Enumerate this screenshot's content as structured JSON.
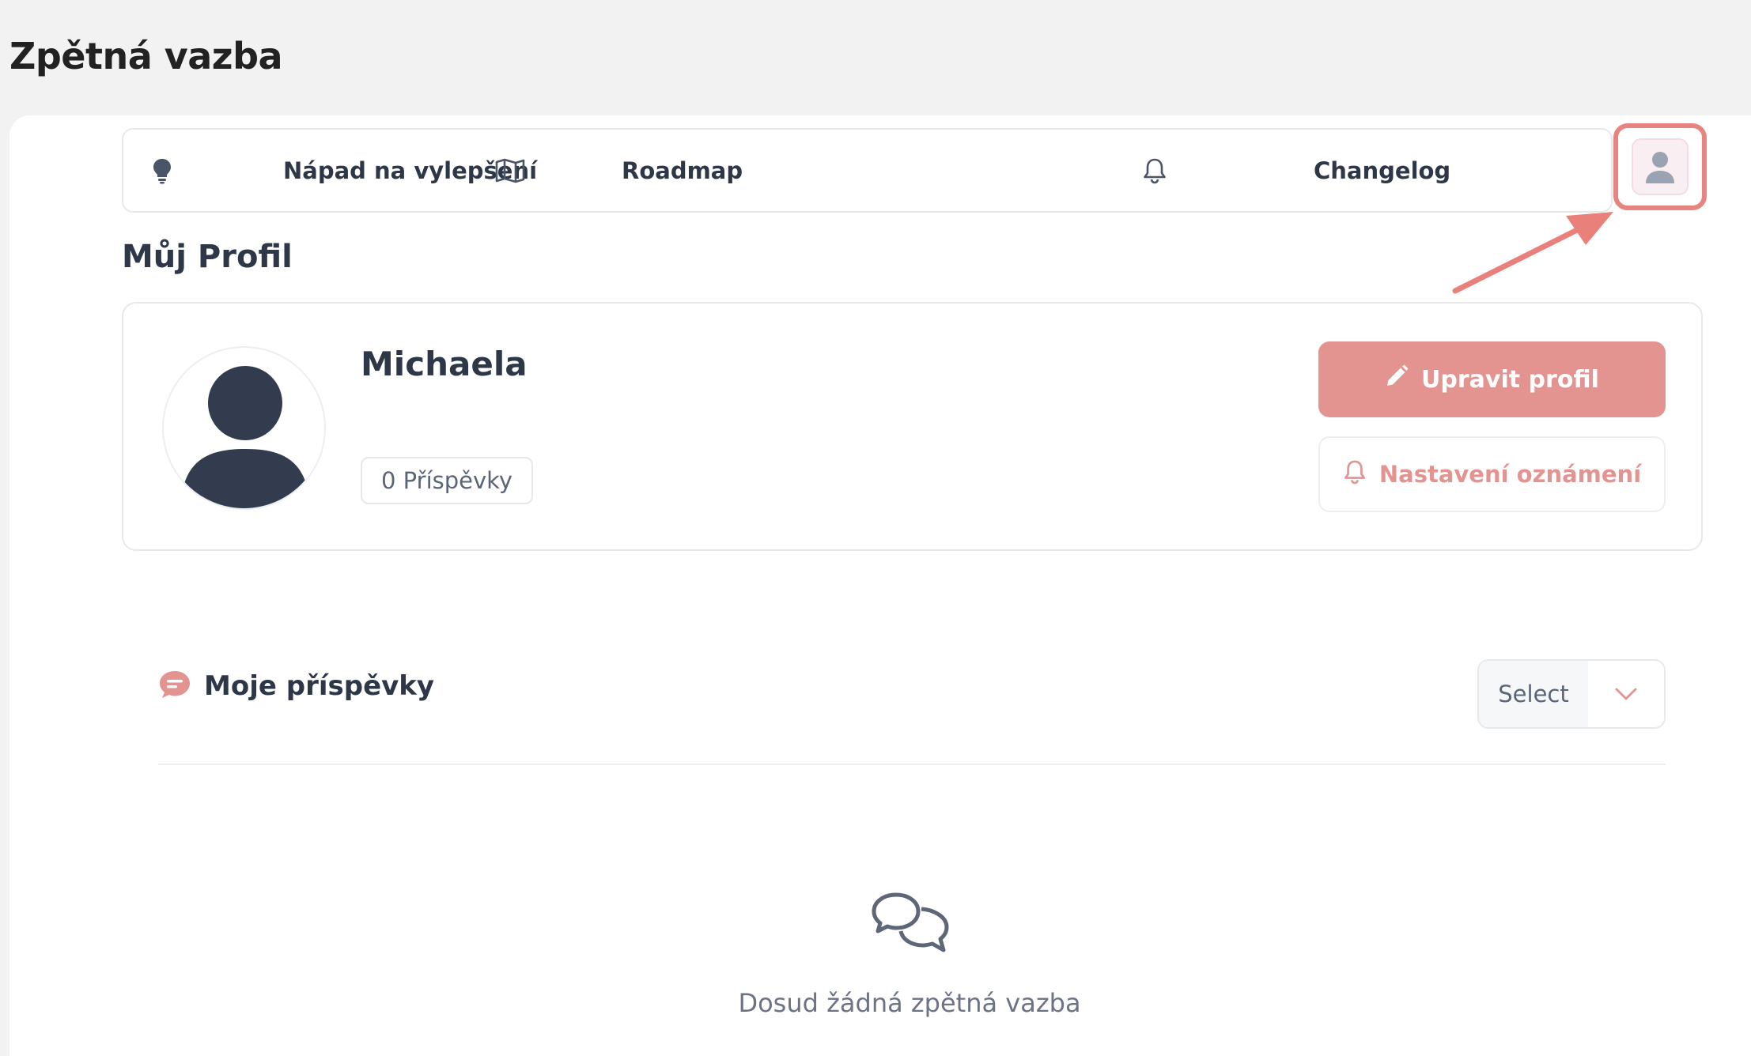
{
  "page": {
    "title": "Zpětná vazba"
  },
  "nav": {
    "items": [
      {
        "label": "Nápad na vylepšení",
        "icon": "lightbulb-icon"
      },
      {
        "label": "Roadmap",
        "icon": "map-icon"
      },
      {
        "label": "Changelog",
        "icon": "bell-icon"
      }
    ],
    "avatar_icon": "user-avatar-icon"
  },
  "profile": {
    "section_title": "Můj Profil",
    "name": "Michaela",
    "posts_count": "0 Příspěvky",
    "edit_button": "Upravit profil",
    "notify_button": "Nastavení oznámení"
  },
  "posts": {
    "title": "Moje příspěvky",
    "select_value": "Select",
    "empty_text": "Dosud žádná zpětná vazba"
  },
  "colors": {
    "accent": "#e39390",
    "highlight": "#e8847f",
    "text_dark": "#2d3748"
  }
}
